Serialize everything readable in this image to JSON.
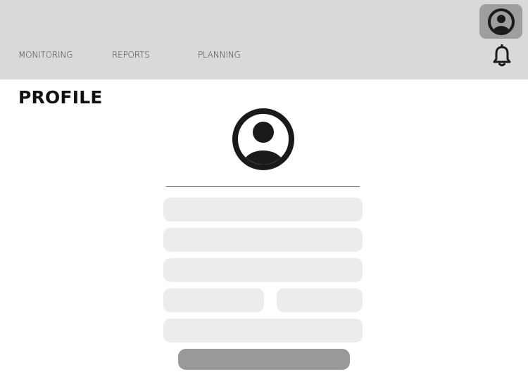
{
  "header": {
    "nav": [
      {
        "label": "MONITORING"
      },
      {
        "label": "REPORTS"
      },
      {
        "label": "PLANNING"
      }
    ],
    "account_icon": "user-circle-icon",
    "notification_icon": "bell-icon"
  },
  "page": {
    "title": "PROFILE",
    "avatar_icon": "user-avatar-icon"
  },
  "form": {
    "fields": [
      {
        "value": "",
        "placeholder": ""
      },
      {
        "value": "",
        "placeholder": ""
      },
      {
        "value": "",
        "placeholder": ""
      },
      {
        "value": "",
        "placeholder": ""
      },
      {
        "value": "",
        "placeholder": ""
      },
      {
        "value": "",
        "placeholder": ""
      }
    ],
    "submit_label": ""
  },
  "colors": {
    "header_bg": "#d9d9d9",
    "account_button_bg": "#9e9e9e",
    "field_bg": "#ececec",
    "submit_bg": "#999999",
    "icon_dark": "#1a1a1a"
  }
}
